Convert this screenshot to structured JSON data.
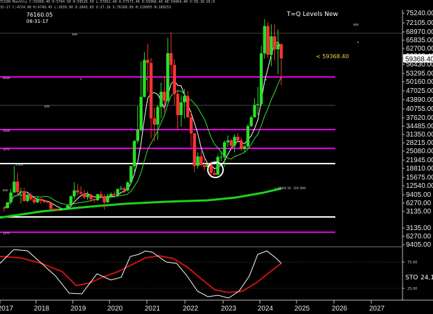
{
  "header": {
    "ticker_line": "TCOIN  Monthly  C:59368.40  H:5794.50  H:59520.50  L:57052.40  A:57573.40  H:59368.40  AE:59464.40  V:50.1K  OI:0"
  },
  "sub_header": {
    "line": "31-17  C:4724.90  H:4749.45  L:2639.90  O:2843.65  V:27.16  S:76160.05  H:210955  N:189253"
  },
  "price_box": {
    "value": "76160.05",
    "date": "08-31-17"
  },
  "title": "T=Q Levels New",
  "current_annotation": "< 59368.40",
  "current_price_tag": "59368.40",
  "sma_annotation": "< 10960.59 - 200 SMA",
  "level_labels": [
    "500",
    "500",
    "2618",
    "500",
    "1618",
    "1272",
    "1.000",
    "500",
    "1272"
  ],
  "oscillator": {
    "label": "STO",
    "value": "24,1",
    "levels": [
      "75.00",
      "25.00"
    ]
  },
  "chart_data": {
    "type": "candlestick",
    "title": "T=Q Levels New",
    "x_ticks": [
      "2017",
      "2018",
      "2019",
      "2020",
      "2021",
      "2022",
      "2023",
      "2024",
      "2025",
      "2026",
      "2027"
    ],
    "y_ticks": [
      "75240.00",
      "72105.00",
      "68970.00",
      "65835.00",
      "62700.00",
      "59368.40",
      "56430.00",
      "53295.00",
      "50160.00",
      "47025.00",
      "43890.00",
      "40755.00",
      "37620.00",
      "34485.00",
      "31350.00",
      "28215.00",
      "25080.00",
      "21945.00",
      "18810.00",
      "15675.00",
      "12540.00",
      "9405.00",
      "6270.00",
      "3135.00",
      "3135.00",
      "6270.00",
      "9405.00"
    ],
    "candles": [
      {
        "date": "2017-09",
        "o": 4400,
        "h": 4900,
        "l": 3000,
        "c": 4300
      },
      {
        "date": "2017-10",
        "o": 4300,
        "h": 6400,
        "l": 4100,
        "c": 6400
      },
      {
        "date": "2017-11",
        "o": 6400,
        "h": 11400,
        "l": 5500,
        "c": 10000
      },
      {
        "date": "2017-12",
        "o": 10000,
        "h": 19800,
        "l": 10800,
        "c": 14000
      },
      {
        "date": "2018-01",
        "o": 14000,
        "h": 17200,
        "l": 9400,
        "c": 10200
      },
      {
        "date": "2018-02",
        "o": 10200,
        "h": 11800,
        "l": 6000,
        "c": 10400
      },
      {
        "date": "2018-03",
        "o": 10400,
        "h": 11700,
        "l": 6600,
        "c": 6900
      },
      {
        "date": "2018-04",
        "o": 6900,
        "h": 9800,
        "l": 6400,
        "c": 9200
      },
      {
        "date": "2018-05",
        "o": 9200,
        "h": 10000,
        "l": 7000,
        "c": 7500
      },
      {
        "date": "2018-06",
        "o": 7500,
        "h": 7800,
        "l": 5800,
        "c": 6400
      },
      {
        "date": "2018-07",
        "o": 6400,
        "h": 8500,
        "l": 6100,
        "c": 7700
      },
      {
        "date": "2018-08",
        "o": 7700,
        "h": 7800,
        "l": 5900,
        "c": 7000
      },
      {
        "date": "2018-09",
        "o": 7000,
        "h": 7400,
        "l": 6100,
        "c": 6600
      },
      {
        "date": "2018-10",
        "o": 6600,
        "h": 7000,
        "l": 6100,
        "c": 6300
      },
      {
        "date": "2018-11",
        "o": 6300,
        "h": 6500,
        "l": 3600,
        "c": 4000
      },
      {
        "date": "2018-12",
        "o": 4000,
        "h": 4200,
        "l": 3100,
        "c": 3700
      },
      {
        "date": "2019-01",
        "o": 3700,
        "h": 4100,
        "l": 3400,
        "c": 3400
      },
      {
        "date": "2019-02",
        "o": 3400,
        "h": 4200,
        "l": 3400,
        "c": 3800
      },
      {
        "date": "2019-03",
        "o": 3800,
        "h": 4100,
        "l": 3700,
        "c": 4100
      },
      {
        "date": "2019-04",
        "o": 4100,
        "h": 5600,
        "l": 4100,
        "c": 5300
      },
      {
        "date": "2019-05",
        "o": 5300,
        "h": 9100,
        "l": 5300,
        "c": 8600
      },
      {
        "date": "2019-06",
        "o": 8600,
        "h": 13800,
        "l": 7500,
        "c": 10800
      },
      {
        "date": "2019-07",
        "o": 10800,
        "h": 13200,
        "l": 9100,
        "c": 10100
      },
      {
        "date": "2019-08",
        "o": 10100,
        "h": 12300,
        "l": 9400,
        "c": 9600
      },
      {
        "date": "2019-09",
        "o": 9600,
        "h": 10900,
        "l": 7700,
        "c": 8300
      },
      {
        "date": "2019-10",
        "o": 8300,
        "h": 10400,
        "l": 7300,
        "c": 9200
      },
      {
        "date": "2019-11",
        "o": 9200,
        "h": 9500,
        "l": 6500,
        "c": 7600
      },
      {
        "date": "2019-12",
        "o": 7600,
        "h": 7700,
        "l": 6400,
        "c": 7200
      },
      {
        "date": "2020-01",
        "o": 7200,
        "h": 9600,
        "l": 6900,
        "c": 9400
      },
      {
        "date": "2020-02",
        "o": 9400,
        "h": 10500,
        "l": 8500,
        "c": 8600
      },
      {
        "date": "2020-03",
        "o": 8600,
        "h": 9200,
        "l": 3800,
        "c": 6400
      },
      {
        "date": "2020-04",
        "o": 6400,
        "h": 9500,
        "l": 6200,
        "c": 8600
      },
      {
        "date": "2020-05",
        "o": 8600,
        "h": 10100,
        "l": 8100,
        "c": 9500
      },
      {
        "date": "2020-06",
        "o": 9500,
        "h": 10400,
        "l": 8900,
        "c": 9100
      },
      {
        "date": "2020-07",
        "o": 9100,
        "h": 11500,
        "l": 9000,
        "c": 11300
      },
      {
        "date": "2020-08",
        "o": 11300,
        "h": 12500,
        "l": 11000,
        "c": 11600
      },
      {
        "date": "2020-09",
        "o": 11600,
        "h": 12100,
        "l": 9900,
        "c": 10800
      },
      {
        "date": "2020-10",
        "o": 10800,
        "h": 14000,
        "l": 10400,
        "c": 13800
      },
      {
        "date": "2020-11",
        "o": 13800,
        "h": 19900,
        "l": 13200,
        "c": 19700
      },
      {
        "date": "2020-12",
        "o": 19700,
        "h": 29300,
        "l": 17600,
        "c": 29000
      },
      {
        "date": "2021-01",
        "o": 29000,
        "h": 41900,
        "l": 28100,
        "c": 33100
      },
      {
        "date": "2021-02",
        "o": 33100,
        "h": 58300,
        "l": 32300,
        "c": 45200
      },
      {
        "date": "2021-03",
        "o": 45200,
        "h": 61700,
        "l": 45000,
        "c": 58800
      },
      {
        "date": "2021-04",
        "o": 58800,
        "h": 64800,
        "l": 47000,
        "c": 57700
      },
      {
        "date": "2021-05",
        "o": 57700,
        "h": 59500,
        "l": 30000,
        "c": 37300
      },
      {
        "date": "2021-06",
        "o": 37300,
        "h": 41300,
        "l": 28800,
        "c": 35000
      },
      {
        "date": "2021-07",
        "o": 35000,
        "h": 42300,
        "l": 29300,
        "c": 41500
      },
      {
        "date": "2021-08",
        "o": 41500,
        "h": 50500,
        "l": 37300,
        "c": 47100
      },
      {
        "date": "2021-09",
        "o": 47100,
        "h": 52900,
        "l": 39600,
        "c": 43800
      },
      {
        "date": "2021-10",
        "o": 43800,
        "h": 67000,
        "l": 43300,
        "c": 61300
      },
      {
        "date": "2021-11",
        "o": 61300,
        "h": 69000,
        "l": 53300,
        "c": 57000
      },
      {
        "date": "2021-12",
        "o": 57000,
        "h": 59100,
        "l": 42000,
        "c": 46300
      },
      {
        "date": "2022-01",
        "o": 46300,
        "h": 47900,
        "l": 33000,
        "c": 38500
      },
      {
        "date": "2022-02",
        "o": 38500,
        "h": 45800,
        "l": 34300,
        "c": 43200
      },
      {
        "date": "2022-03",
        "o": 43200,
        "h": 48200,
        "l": 37200,
        "c": 45500
      },
      {
        "date": "2022-04",
        "o": 45500,
        "h": 47400,
        "l": 37600,
        "c": 37700
      },
      {
        "date": "2022-05",
        "o": 37700,
        "h": 40000,
        "l": 26700,
        "c": 31800
      },
      {
        "date": "2022-06",
        "o": 31800,
        "h": 31900,
        "l": 17600,
        "c": 19800
      },
      {
        "date": "2022-07",
        "o": 19800,
        "h": 24700,
        "l": 18800,
        "c": 23300
      },
      {
        "date": "2022-08",
        "o": 23300,
        "h": 25200,
        "l": 19600,
        "c": 20100
      },
      {
        "date": "2022-09",
        "o": 20100,
        "h": 22800,
        "l": 18200,
        "c": 19400
      },
      {
        "date": "2022-10",
        "o": 19400,
        "h": 20900,
        "l": 18200,
        "c": 20500
      },
      {
        "date": "2022-11",
        "o": 20500,
        "h": 21500,
        "l": 15500,
        "c": 17200
      },
      {
        "date": "2022-12",
        "o": 17200,
        "h": 18400,
        "l": 16300,
        "c": 16500
      },
      {
        "date": "2023-01",
        "o": 16500,
        "h": 23900,
        "l": 16500,
        "c": 23100
      },
      {
        "date": "2023-02",
        "o": 23100,
        "h": 25200,
        "l": 21400,
        "c": 23100
      },
      {
        "date": "2023-03",
        "o": 23100,
        "h": 29200,
        "l": 19500,
        "c": 28500
      },
      {
        "date": "2023-04",
        "o": 28500,
        "h": 31000,
        "l": 26900,
        "c": 29200
      },
      {
        "date": "2023-05",
        "o": 29200,
        "h": 29800,
        "l": 25800,
        "c": 27200
      },
      {
        "date": "2023-06",
        "o": 27200,
        "h": 31400,
        "l": 24800,
        "c": 30500
      },
      {
        "date": "2023-07",
        "o": 30500,
        "h": 31800,
        "l": 28900,
        "c": 29200
      },
      {
        "date": "2023-08",
        "o": 29200,
        "h": 30200,
        "l": 25300,
        "c": 26000
      },
      {
        "date": "2023-09",
        "o": 26000,
        "h": 27500,
        "l": 24900,
        "c": 27000
      },
      {
        "date": "2023-10",
        "o": 27000,
        "h": 35200,
        "l": 26600,
        "c": 34500
      },
      {
        "date": "2023-11",
        "o": 34500,
        "h": 38400,
        "l": 34100,
        "c": 37700
      },
      {
        "date": "2023-12",
        "o": 37700,
        "h": 44700,
        "l": 37600,
        "c": 42300
      },
      {
        "date": "2024-01",
        "o": 42300,
        "h": 48900,
        "l": 38500,
        "c": 42600
      },
      {
        "date": "2024-02",
        "o": 42600,
        "h": 64000,
        "l": 41900,
        "c": 61200
      },
      {
        "date": "2024-03",
        "o": 61200,
        "h": 73800,
        "l": 59300,
        "c": 71300
      },
      {
        "date": "2024-04",
        "o": 71300,
        "h": 72800,
        "l": 59600,
        "c": 60700
      },
      {
        "date": "2024-05",
        "o": 60700,
        "h": 71900,
        "l": 56500,
        "c": 67500
      },
      {
        "date": "2024-06",
        "o": 67500,
        "h": 71900,
        "l": 58600,
        "c": 62700
      },
      {
        "date": "2024-07",
        "o": 62700,
        "h": 70000,
        "l": 53500,
        "c": 64600
      },
      {
        "date": "2024-08",
        "o": 64600,
        "h": 65000,
        "l": 49500,
        "c": 59368.4
      }
    ],
    "level_lines": [
      {
        "label": "500",
        "color": "#ffffff"
      },
      {
        "label": "2618",
        "color": "#ff00ff"
      },
      {
        "label": "500",
        "color": "#ffffff"
      },
      {
        "label": "1618",
        "color": "#ff00ff"
      },
      {
        "label": "1272",
        "color": "#ff00ff"
      },
      {
        "label": "1.000",
        "color": "#ffffff"
      },
      {
        "label": "500",
        "color": "#ffffff"
      },
      {
        "label": "1272",
        "color": "#ff00ff"
      }
    ],
    "series": [
      {
        "name": "200 SMA"
      }
    ]
  },
  "colors": {
    "bull": "#29e029",
    "bear": "#ff3333",
    "level_magenta": "#e600e6",
    "sma_green": "#1ed21e",
    "stoch_red": "#cc1111",
    "background": "#000000"
  }
}
